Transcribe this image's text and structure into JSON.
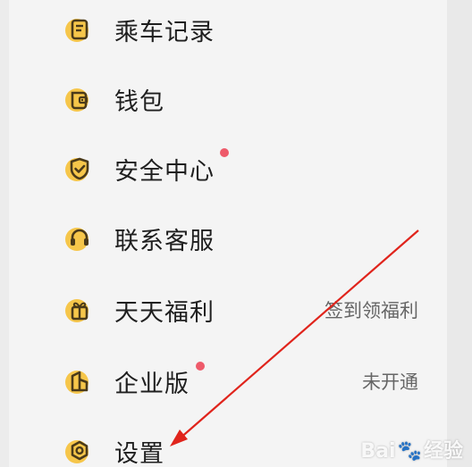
{
  "menu": {
    "items": [
      {
        "label": "乘车记录",
        "icon": "receipt-icon"
      },
      {
        "label": "钱包",
        "icon": "wallet-icon"
      },
      {
        "label": "安全中心",
        "icon": "shield-check-icon",
        "badge_color": "#ee5a6a"
      },
      {
        "label": "联系客服",
        "icon": "headset-icon"
      },
      {
        "label": "天天福利",
        "icon": "gift-icon",
        "extra": "签到领福利"
      },
      {
        "label": "企业版",
        "icon": "building-icon",
        "badge_color": "#ee5a6a",
        "extra": "未开通"
      },
      {
        "label": "设置",
        "icon": "gear-icon"
      }
    ]
  },
  "annotation": {
    "arrow_color": "#e0241c"
  },
  "watermark": {
    "text_a": "Bai",
    "text_b": "经验"
  },
  "colors": {
    "icon_yellow": "#f6c64a",
    "icon_dark": "#4a3a1a",
    "badge": "#ee5a6a"
  }
}
